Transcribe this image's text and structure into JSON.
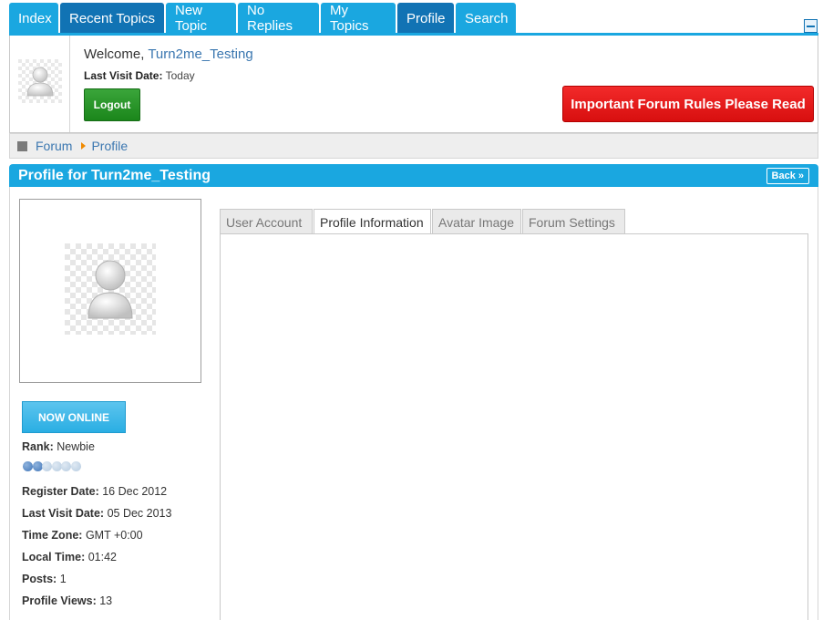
{
  "nav": {
    "tabs": [
      {
        "label": "Index"
      },
      {
        "label": "Recent Topics"
      },
      {
        "label": "New Topic"
      },
      {
        "label": "No Replies"
      },
      {
        "label": "My Topics"
      },
      {
        "label": "Profile"
      },
      {
        "label": "Search"
      }
    ]
  },
  "welcome": {
    "greeting": "Welcome,",
    "username": "Turn2me_Testing",
    "last_visit_label": "Last Visit Date:",
    "last_visit_value": "Today",
    "logout_label": "Logout",
    "rules_label": "Important Forum Rules Please Read"
  },
  "breadcrumb": {
    "items": [
      "Forum",
      "Profile"
    ]
  },
  "profile": {
    "title": "Profile for Turn2me_Testing",
    "back_label": "Back »",
    "online_label": "NOW ONLINE",
    "rank_label": "Rank:",
    "rank_value": "Newbie",
    "rank_level": {
      "filled": 2,
      "total": 6
    },
    "stats": [
      {
        "label": "Register Date:",
        "value": "16 Dec 2012"
      },
      {
        "label": "Last Visit Date:",
        "value": "05 Dec 2013"
      },
      {
        "label": "Time Zone:",
        "value": "GMT +0:00"
      },
      {
        "label": "Local Time:",
        "value": "01:42"
      },
      {
        "label": "Posts:",
        "value": "1"
      },
      {
        "label": "Profile Views:",
        "value": "13"
      }
    ],
    "tabs": [
      {
        "label": "User Account"
      },
      {
        "label": "Profile Information"
      },
      {
        "label": "Avatar Image"
      },
      {
        "label": "Forum Settings"
      }
    ],
    "active_tab": "Profile Information"
  },
  "colors": {
    "tab_blue": "#1aa7e0",
    "tab_dark": "#1173b4",
    "logout_green": "#1b861b",
    "rules_red": "#e01515",
    "link_blue": "#3b77b0"
  }
}
